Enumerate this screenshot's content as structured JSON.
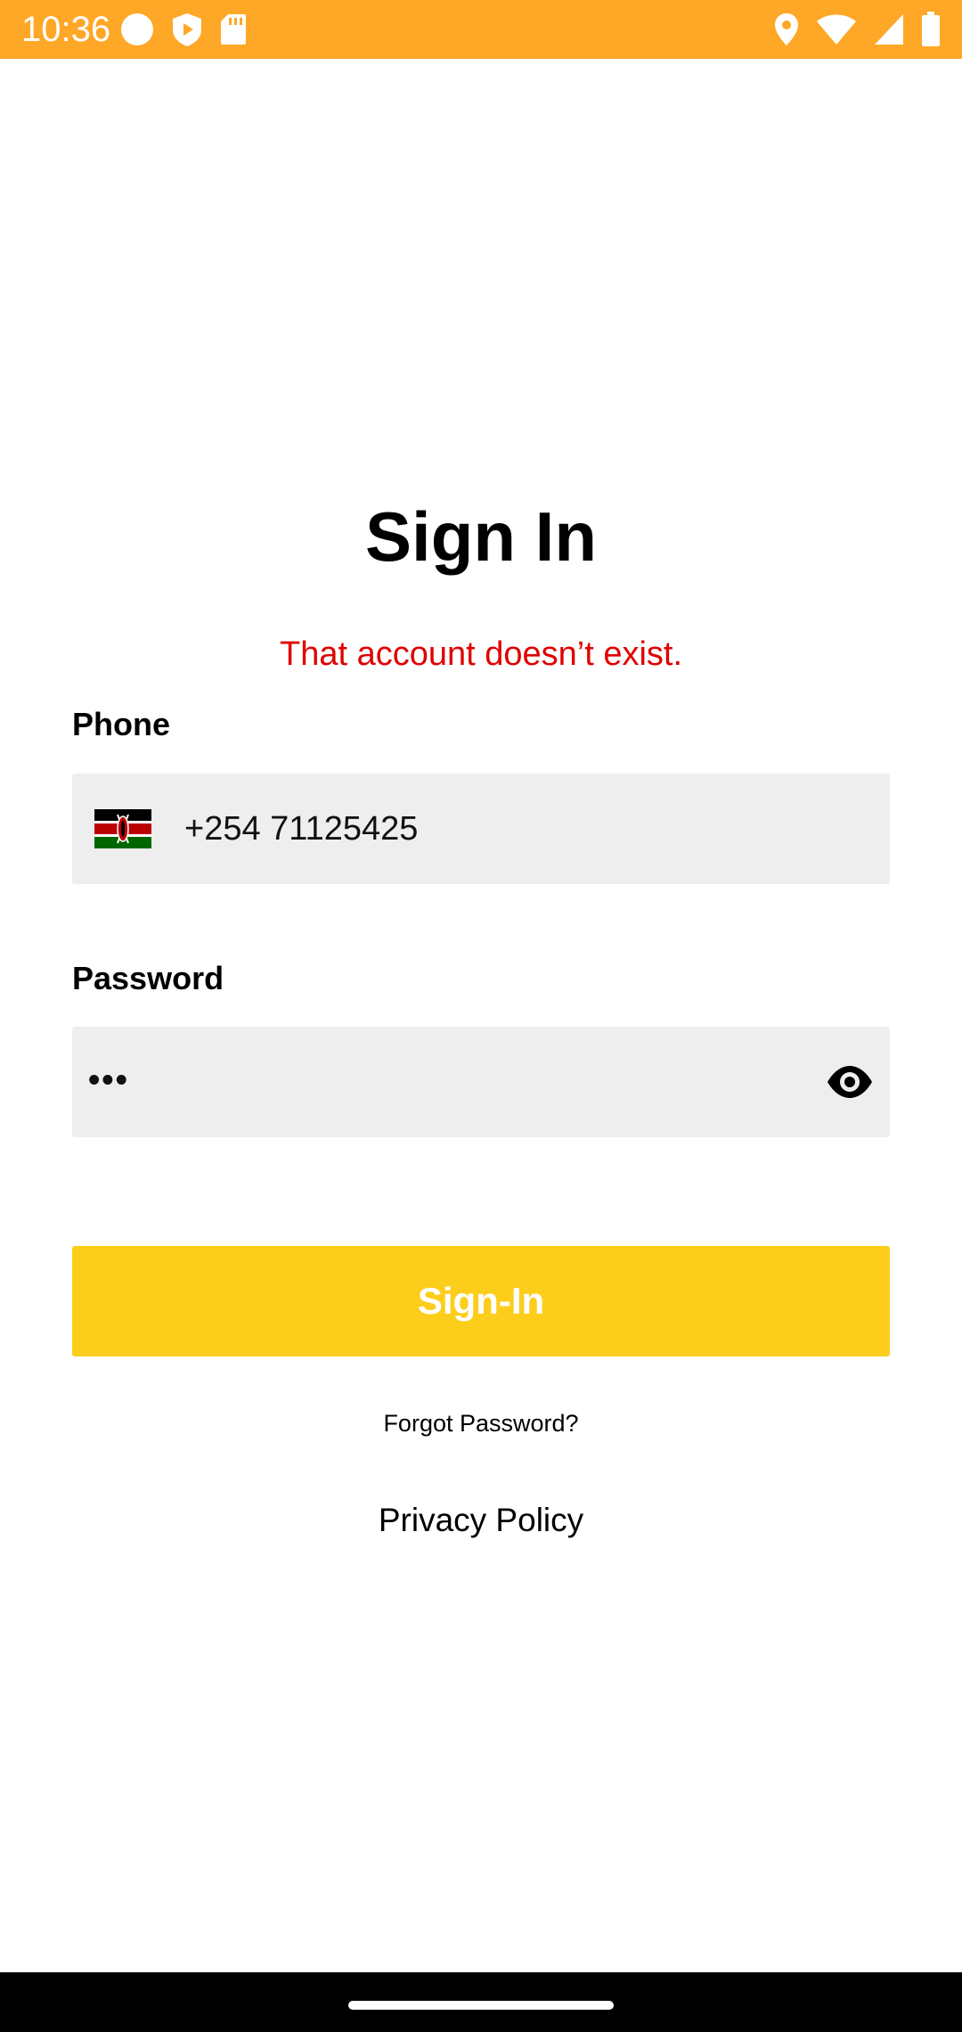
{
  "status_bar": {
    "time": "10:36",
    "left_icons": [
      "circle-notification-icon",
      "shield-play-icon",
      "sd-card-icon"
    ],
    "right_icons": [
      "location-icon",
      "wifi-icon",
      "signal-icon",
      "battery-icon"
    ],
    "background": "#FFA726"
  },
  "page": {
    "title": "Sign In",
    "error_message": "That account doesn’t exist.",
    "error_color": "#E00000"
  },
  "phone": {
    "label": "Phone",
    "country_flag": "kenya-flag-icon",
    "value": "+254 71125425"
  },
  "password": {
    "label": "Password",
    "masked_value": "•••",
    "toggle_icon": "eye-icon"
  },
  "actions": {
    "signin_label": "Sign-In",
    "signin_color": "#FDCD1B",
    "forgot_label": "Forgot Password?",
    "privacy_label": "Privacy Policy"
  }
}
